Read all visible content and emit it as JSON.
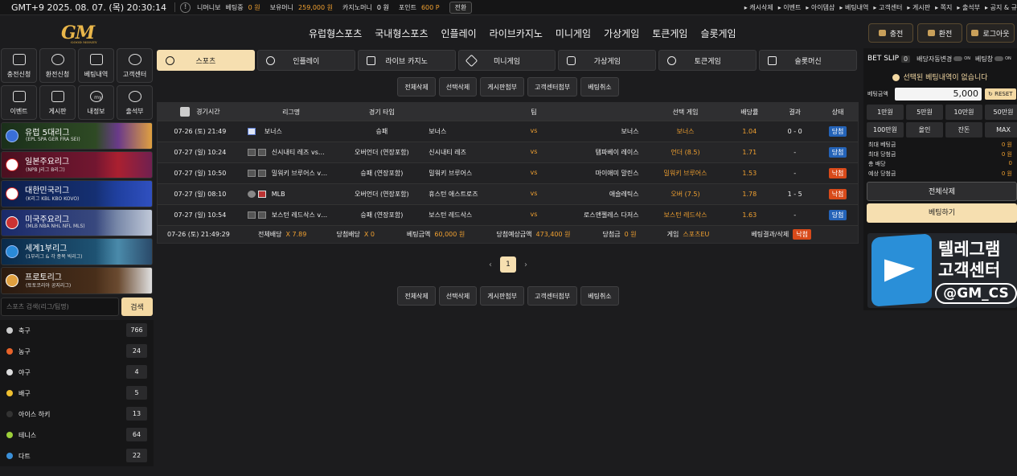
{
  "topbar": {
    "clock": "GMT+9 2025. 08. 07. (목) 20:30:14",
    "warning_icon": "exclamation-circle-icon",
    "username": "니머니보",
    "bet_label": "베팅중",
    "bet_value": "0 원",
    "balance_label": "보유머니",
    "balance_value": "259,000 원",
    "casino_label": "카지노머니",
    "casino_value": "0 원",
    "point_label": "포인트",
    "point_value": "600 P",
    "convert_label": "전환",
    "links": [
      "캐시삭제",
      "이벤트",
      "아이템샵",
      "베팅내역",
      "고객센터",
      "게시판",
      "쪽지",
      "출석부",
      "공지 & 규"
    ]
  },
  "header": {
    "logo_text": "GM",
    "logo_sub": "GOOD MONEY",
    "nav": [
      "유럽형스포츠",
      "국내형스포츠",
      "인플레이",
      "라이브카지노",
      "미니게임",
      "가상게임",
      "토큰게임",
      "슬롯게임"
    ],
    "buttons": [
      "충전",
      "환전",
      "로그아웃"
    ]
  },
  "left": {
    "grid": [
      "충전신청",
      "환전신청",
      "베팅내역",
      "고객센터",
      "이벤트",
      "게시판",
      "내정보",
      "출석부"
    ],
    "grid_icon_labels": [
      "my"
    ],
    "banners": [
      {
        "title": "유럽 5대리그",
        "sub": "(EPL SPA GER FRA SEI)"
      },
      {
        "title": "일본주요리그",
        "sub": "(NPB J리그 B리그)"
      },
      {
        "title": "대한민국리그",
        "sub": "(K리그 KBL KBO KOVO)"
      },
      {
        "title": "미국주요리그",
        "sub": "(MLB NBA NHL NFL MLS)"
      },
      {
        "title": "세계1부리그",
        "sub": "(1부리그 & 각 종목 빅리그)"
      },
      {
        "title": "프로토리그",
        "sub": "(토토코리아 공지리그)"
      }
    ],
    "search_placeholder": "스포츠 검색(리그/팀명)",
    "search_button": "검색",
    "sports": [
      {
        "name": "축구",
        "count": "766",
        "color": "#cccccc"
      },
      {
        "name": "농구",
        "count": "24",
        "color": "#e8632a"
      },
      {
        "name": "야구",
        "count": "4",
        "color": "#dddddd"
      },
      {
        "name": "배구",
        "count": "5",
        "color": "#f0c030"
      },
      {
        "name": "아이스 하키",
        "count": "13",
        "color": "#333333"
      },
      {
        "name": "테니스",
        "count": "64",
        "color": "#9ccf3a"
      },
      {
        "name": "다트",
        "count": "22",
        "color": "#3a8fd8"
      }
    ]
  },
  "center": {
    "tabs": [
      "스포츠",
      "인플레이",
      "라이브 카지노",
      "미니게임",
      "가상게임",
      "토큰게임",
      "슬롯머신"
    ],
    "actions": [
      "전체삭제",
      "선택삭제",
      "게시판첨부",
      "고객센터첨부",
      "베팅취소"
    ],
    "columns": [
      "경기시간",
      "리그명",
      "경기 타입",
      "팀",
      "선택 게임",
      "배당률",
      "결과",
      "상태"
    ],
    "rows": [
      {
        "time": "07-26 (토) 21:49",
        "league": "보너스",
        "type": "승패",
        "home": "보너스",
        "vs": "vs",
        "away": "보너스",
        "pick": "보너스",
        "odds": "1.04",
        "result": "0 - 0",
        "status": "당첨"
      },
      {
        "time": "07-27 (일) 10:24",
        "league": "신시내티 레즈 vs…",
        "type": "오버언더 (연장포함)",
        "home": "신시내티 레즈",
        "vs": "vs",
        "away": "탬파베이 레이스",
        "pick": "언더 (8.5)",
        "odds": "1.71",
        "result": "-",
        "status": "당첨"
      },
      {
        "time": "07-27 (일) 10:50",
        "league": "밀워키 브루어스 v…",
        "type": "승패 (연장포함)",
        "home": "밀워키 브루어스",
        "vs": "vs",
        "away": "마이애미 말린스",
        "pick": "밀워키 브루어스",
        "odds": "1.53",
        "result": "-",
        "status": "낙첨"
      },
      {
        "time": "07-27 (일) 08:10",
        "league": "MLB",
        "type": "오버언더 (연장포함)",
        "home": "휴스턴 애스트로즈",
        "vs": "vs",
        "away": "애슬레틱스",
        "pick": "오버 (7.5)",
        "odds": "1.78",
        "result": "1 - 5",
        "status": "낙첨"
      },
      {
        "time": "07-27 (일) 10:54",
        "league": "보스턴 레드삭스 v…",
        "type": "승패 (연장포함)",
        "home": "보스턴 레드삭스",
        "vs": "vs",
        "away": "로스앤젤레스 다저스",
        "pick": "보스턴 레드삭스",
        "odds": "1.63",
        "result": "-",
        "status": "당첨"
      }
    ],
    "summary": {
      "time": "07-26 (토) 21:49:29",
      "total_odds_label": "전체배당",
      "total_odds": "X 7.89",
      "win_odds_label": "당첨배당",
      "win_odds": "X 0",
      "bet_amount_label": "베팅금액",
      "bet_amount": "60,000 원",
      "expected_label": "당첨예상금액",
      "expected": "473,400 원",
      "won_label": "당첨금",
      "won": "0 원",
      "game_label": "게임",
      "game": "스포츠EU",
      "result_label": "베팅결과/삭제",
      "result": "낙첨"
    },
    "pager": {
      "prev": "‹",
      "current": "1",
      "next": "›"
    }
  },
  "betslip": {
    "title": "BET SLIP",
    "count": "0",
    "auto_label": "배당자동변경",
    "toggle_on": "ON",
    "keep_label": "베팅창",
    "message": "선택된 베팅내역이 없습니다",
    "amount_label": "베팅금액",
    "amount": "5,000",
    "reset": "RESET",
    "quick": [
      "1만원",
      "5만원",
      "10만원",
      "50만원",
      "100만원",
      "올인",
      "잔돈",
      "MAX"
    ],
    "info": [
      {
        "label": "최대 베팅금",
        "value": "0 원"
      },
      {
        "label": "최대 당첨금",
        "value": "0 원"
      },
      {
        "label": "총 배당",
        "value": "0"
      },
      {
        "label": "예상 당첨금",
        "value": "0 원"
      }
    ],
    "clear_all": "전체삭제",
    "place_bet": "베팅하기"
  },
  "telegram": {
    "line1": "텔레그램",
    "line2": "고객센터",
    "handle": "@GM_CS"
  }
}
